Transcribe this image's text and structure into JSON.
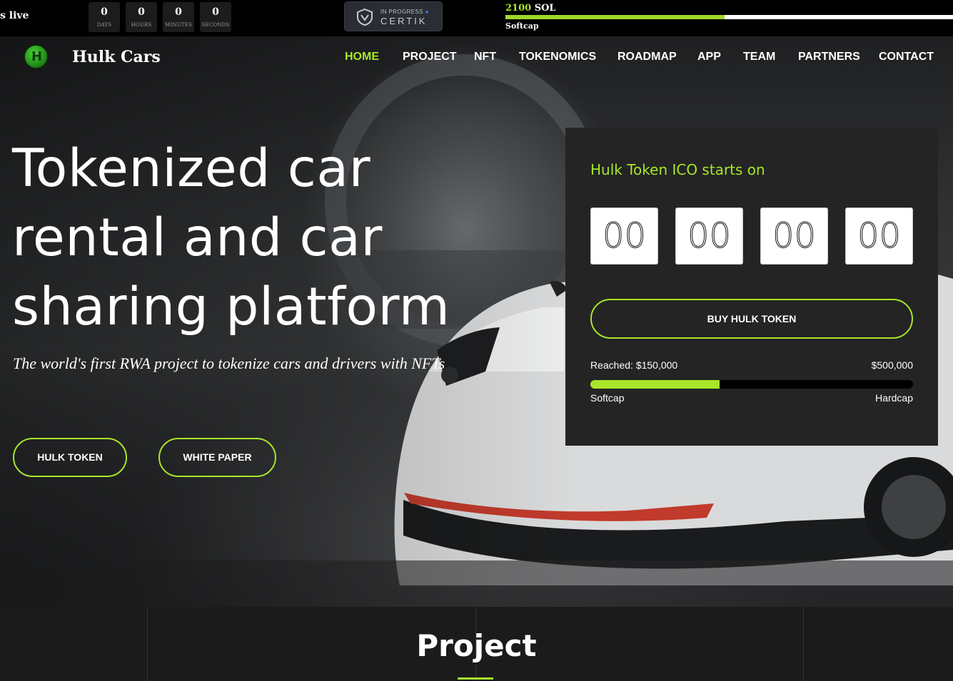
{
  "topbar": {
    "live_text": "s live",
    "countdown": [
      {
        "value": "0",
        "label": "DAYS"
      },
      {
        "value": "0",
        "label": "HOURS"
      },
      {
        "value": "0",
        "label": "MINUTES"
      },
      {
        "value": "0",
        "label": "SECONDS"
      }
    ],
    "certik": {
      "status": "IN PROGRESS",
      "brand": "CERTIK",
      "icon": "certik-shield-icon"
    },
    "sol": {
      "amount": "2100",
      "unit": "SOL",
      "label": "Softcap",
      "progress": 0.49
    }
  },
  "nav": {
    "brand": "Hulk Cars",
    "logo_letter": "H",
    "items": [
      {
        "label": "HOME",
        "active": true
      },
      {
        "label": "PROJECT"
      },
      {
        "label": "NFT"
      },
      {
        "label": "TOKENOMICS"
      },
      {
        "label": "ROADMAP"
      },
      {
        "label": "APP"
      },
      {
        "label": "TEAM"
      },
      {
        "label": "PARTNERS"
      },
      {
        "label": "CONTACT"
      }
    ]
  },
  "hero": {
    "headline": [
      "Tokenized car",
      "rental and car",
      "sharing platform"
    ],
    "tagline": "The world's first RWA project to tokenize cars and drivers with NFTs",
    "buttons": {
      "token": "HULK TOKEN",
      "paper": "WHITE PAPER"
    }
  },
  "ico": {
    "title": "Hulk Token ICO starts on",
    "countdown": [
      "00",
      "00",
      "00",
      "00"
    ],
    "buy_label": "BUY HULK TOKEN",
    "reached_label": "Reached: $150,000",
    "hardcap_amount": "$500,000",
    "softcap_label": "Softcap",
    "hardcap_label": "Hardcap",
    "progress": 0.4
  },
  "project": {
    "title": "Project"
  },
  "colors": {
    "accent": "#a8e62a",
    "panel": "#242424",
    "background": "#000000"
  }
}
